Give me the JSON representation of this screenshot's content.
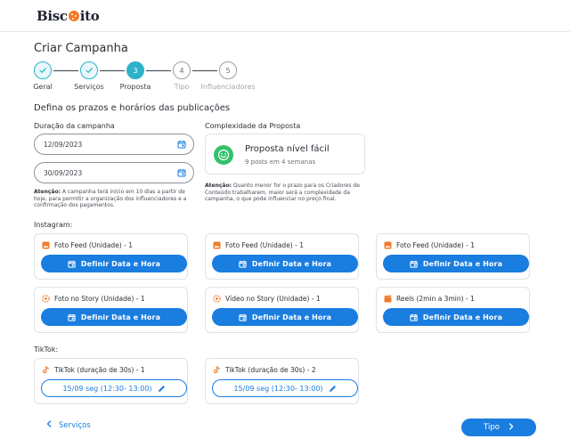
{
  "brand": {
    "logo_left": "Bisc",
    "logo_right": "ito"
  },
  "page": {
    "title": "Criar Campanha",
    "section_title": "Defina os prazos e horários das publicações"
  },
  "stepper": {
    "steps": [
      {
        "number": "1",
        "label": "Geral",
        "state": "done"
      },
      {
        "number": "2",
        "label": "Serviços",
        "state": "done"
      },
      {
        "number": "3",
        "label": "Proposta",
        "state": "active"
      },
      {
        "number": "4",
        "label": "Tipo",
        "state": "todo"
      },
      {
        "number": "5",
        "label": "Influenciadores",
        "state": "todo"
      }
    ]
  },
  "duration": {
    "label": "Duração da campanha",
    "start_date": "12/09/2023",
    "end_date": "30/09/2023",
    "note_bold": "Atenção:",
    "note_text": " A campanha terá início em 10 dias a partir de hoje, para permitir a organização dos influenciadores e a confirmação dos pagamentos."
  },
  "complexity": {
    "label": "Complexidade da Proposta",
    "title": "Proposta nível fácil",
    "subtitle": "9 posts em 4 semanas",
    "note_bold": "Atenção:",
    "note_text": " Quanto menor for o prazo para os Criadores de Conteúdo trabalharem, maior será a complexidade da campanha, o que pode influenciar no preço final."
  },
  "instagram": {
    "label": "Instagram:",
    "button_label": "Definir Data e Hora",
    "items": [
      {
        "title": "Foto Feed (Unidade) - 1",
        "icon": "image-icon"
      },
      {
        "title": "Foto Feed (Unidade) - 1",
        "icon": "image-icon"
      },
      {
        "title": "Foto Feed (Unidade) - 1",
        "icon": "image-icon"
      },
      {
        "title": "Foto no Story (Unidade) - 1",
        "icon": "story-icon"
      },
      {
        "title": "Vídeo no Story (Unidade) - 1",
        "icon": "story-icon"
      },
      {
        "title": "Reels (2min a 3min) - 1",
        "icon": "clapperboard-icon"
      }
    ]
  },
  "tiktok": {
    "label": "TikTok:",
    "items": [
      {
        "title": "TikTok (duração de 30s) - 1",
        "schedule": "15/09 seg (12:30- 13:00)",
        "icon": "tiktok-icon"
      },
      {
        "title": "TikTok (duração de 30s) - 2",
        "schedule": "15/09 seg (12:30- 13:00)",
        "icon": "tiktok-icon"
      }
    ]
  },
  "footer": {
    "back_label": "Serviços",
    "next_label": "Tipo"
  },
  "colors": {
    "primary": "#1a7de0",
    "accent": "#2bb3c9",
    "orange": "#f07a2a",
    "success": "#35c06c"
  }
}
